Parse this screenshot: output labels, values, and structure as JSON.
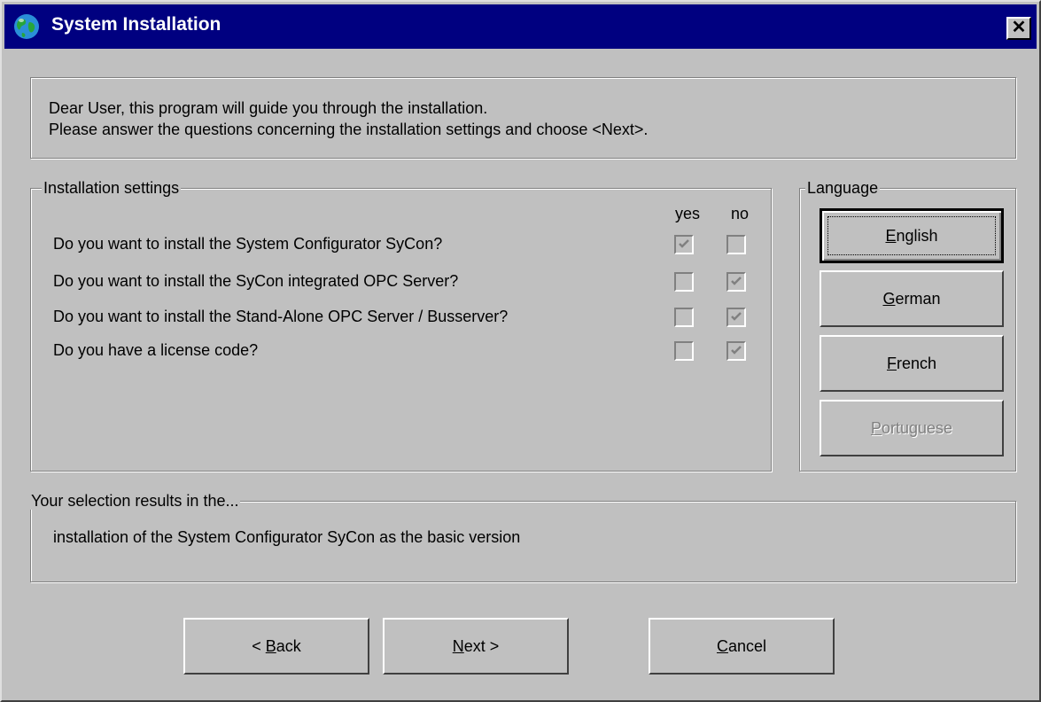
{
  "window": {
    "title": "System Installation",
    "close_glyph": "✕"
  },
  "intro": {
    "line1": "Dear User, this program will guide you through the installation.",
    "line2": "Please answer the questions concerning the installation settings and choose <Next>."
  },
  "settings": {
    "legend": "Installation settings",
    "yes_label": "yes",
    "no_label": "no",
    "questions": [
      {
        "text": "Do you want to install the System Configurator SyCon?",
        "yes": true,
        "no": false
      },
      {
        "text": "Do you want to install the SyCon integrated OPC Server?",
        "yes": false,
        "no": true
      },
      {
        "text": "Do you want to install the Stand-Alone OPC Server / Busserver?",
        "yes": false,
        "no": true
      },
      {
        "text": "Do you have a license code?",
        "yes": false,
        "no": true
      }
    ]
  },
  "language": {
    "legend": "Language",
    "english": {
      "first": "E",
      "rest": "nglish"
    },
    "german": {
      "first": "G",
      "rest": "erman"
    },
    "french": {
      "first": "F",
      "rest": "rench"
    },
    "portuguese": {
      "first": "P",
      "rest": "ortuguese"
    }
  },
  "result": {
    "legend": "Your selection results in the...",
    "text": "installation of the System Configurator SyCon as the basic version"
  },
  "buttons": {
    "back": {
      "pre": "< ",
      "first": "B",
      "rest": "ack"
    },
    "next": {
      "first": "N",
      "rest": "ext >"
    },
    "cancel": {
      "first": "C",
      "rest": "ancel"
    }
  },
  "colors": {
    "titlebar": "#000080",
    "face": "#c0c0c0",
    "disabled_text": "#808080"
  }
}
